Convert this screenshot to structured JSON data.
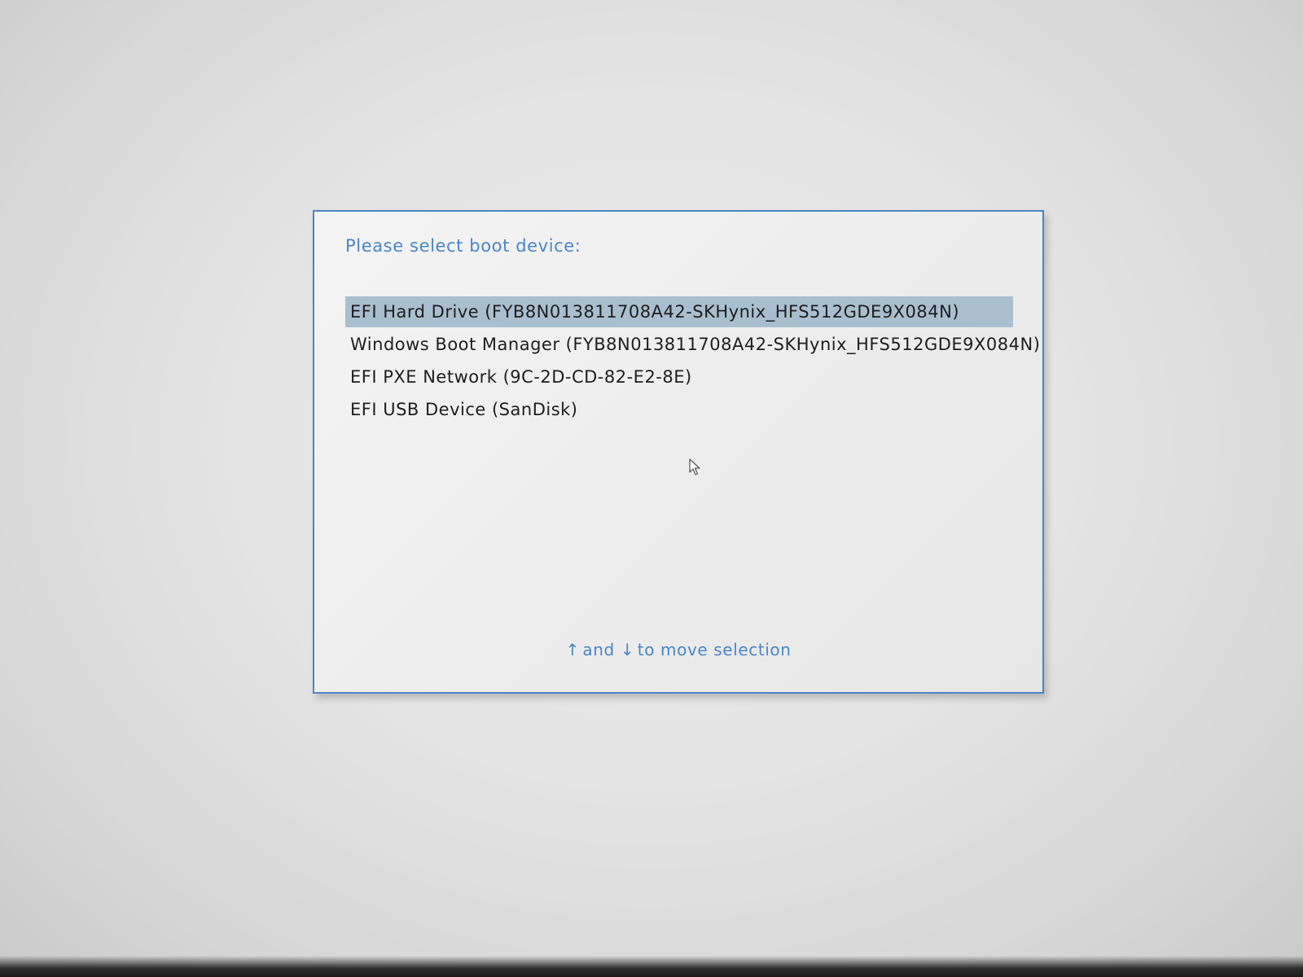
{
  "dialog": {
    "prompt": "Please select boot device:",
    "devices": [
      {
        "label": "EFI Hard Drive (FYB8N013811708A42-SKHynix_HFS512GDE9X084N)",
        "selected": true
      },
      {
        "label": "Windows Boot Manager (FYB8N013811708A42-SKHynix_HFS512GDE9X084N)",
        "selected": false
      },
      {
        "label": "EFI PXE Network (9C-2D-CD-82-E2-8E)",
        "selected": false
      },
      {
        "label": "EFI USB Device (SanDisk)",
        "selected": false
      }
    ],
    "hint": {
      "up_arrow": "↑",
      "and_text": "and",
      "down_arrow": "↓",
      "rest_text": "to move selection"
    }
  },
  "colors": {
    "accent": "#4a86c8",
    "selection": "#a9bfcf",
    "text": "#1e1e1e"
  },
  "icons": {
    "cursor": "mouse-pointer-icon",
    "up": "up-arrow-icon",
    "down": "down-arrow-icon"
  }
}
